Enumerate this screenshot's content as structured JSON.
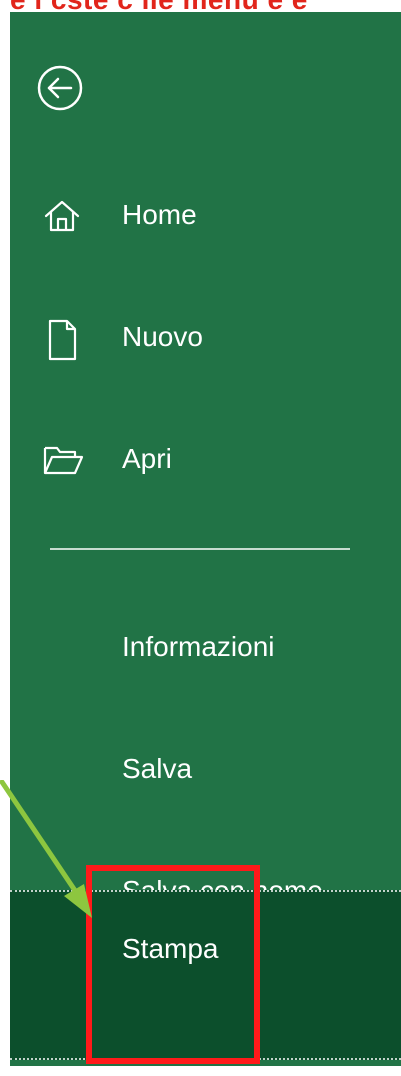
{
  "top_text": "e i cste c ile menu e e",
  "menu": {
    "back_icon": "back-circle-arrow-icon",
    "items": [
      {
        "label": "Home",
        "icon": "home-icon"
      },
      {
        "label": "Nuovo",
        "icon": "new-document-icon"
      },
      {
        "label": "Apri",
        "icon": "open-folder-icon"
      },
      {
        "label": "Informazioni"
      },
      {
        "label": "Salva"
      },
      {
        "label": "Salva con nome"
      },
      {
        "label": "Stampa",
        "selected": true
      }
    ]
  },
  "colors": {
    "panel_bg": "#217346",
    "selected_bg": "#0c4f2c",
    "text": "#ffffff",
    "annotation_red": "#ff1a1a",
    "annotation_green": "#8dc63f"
  }
}
